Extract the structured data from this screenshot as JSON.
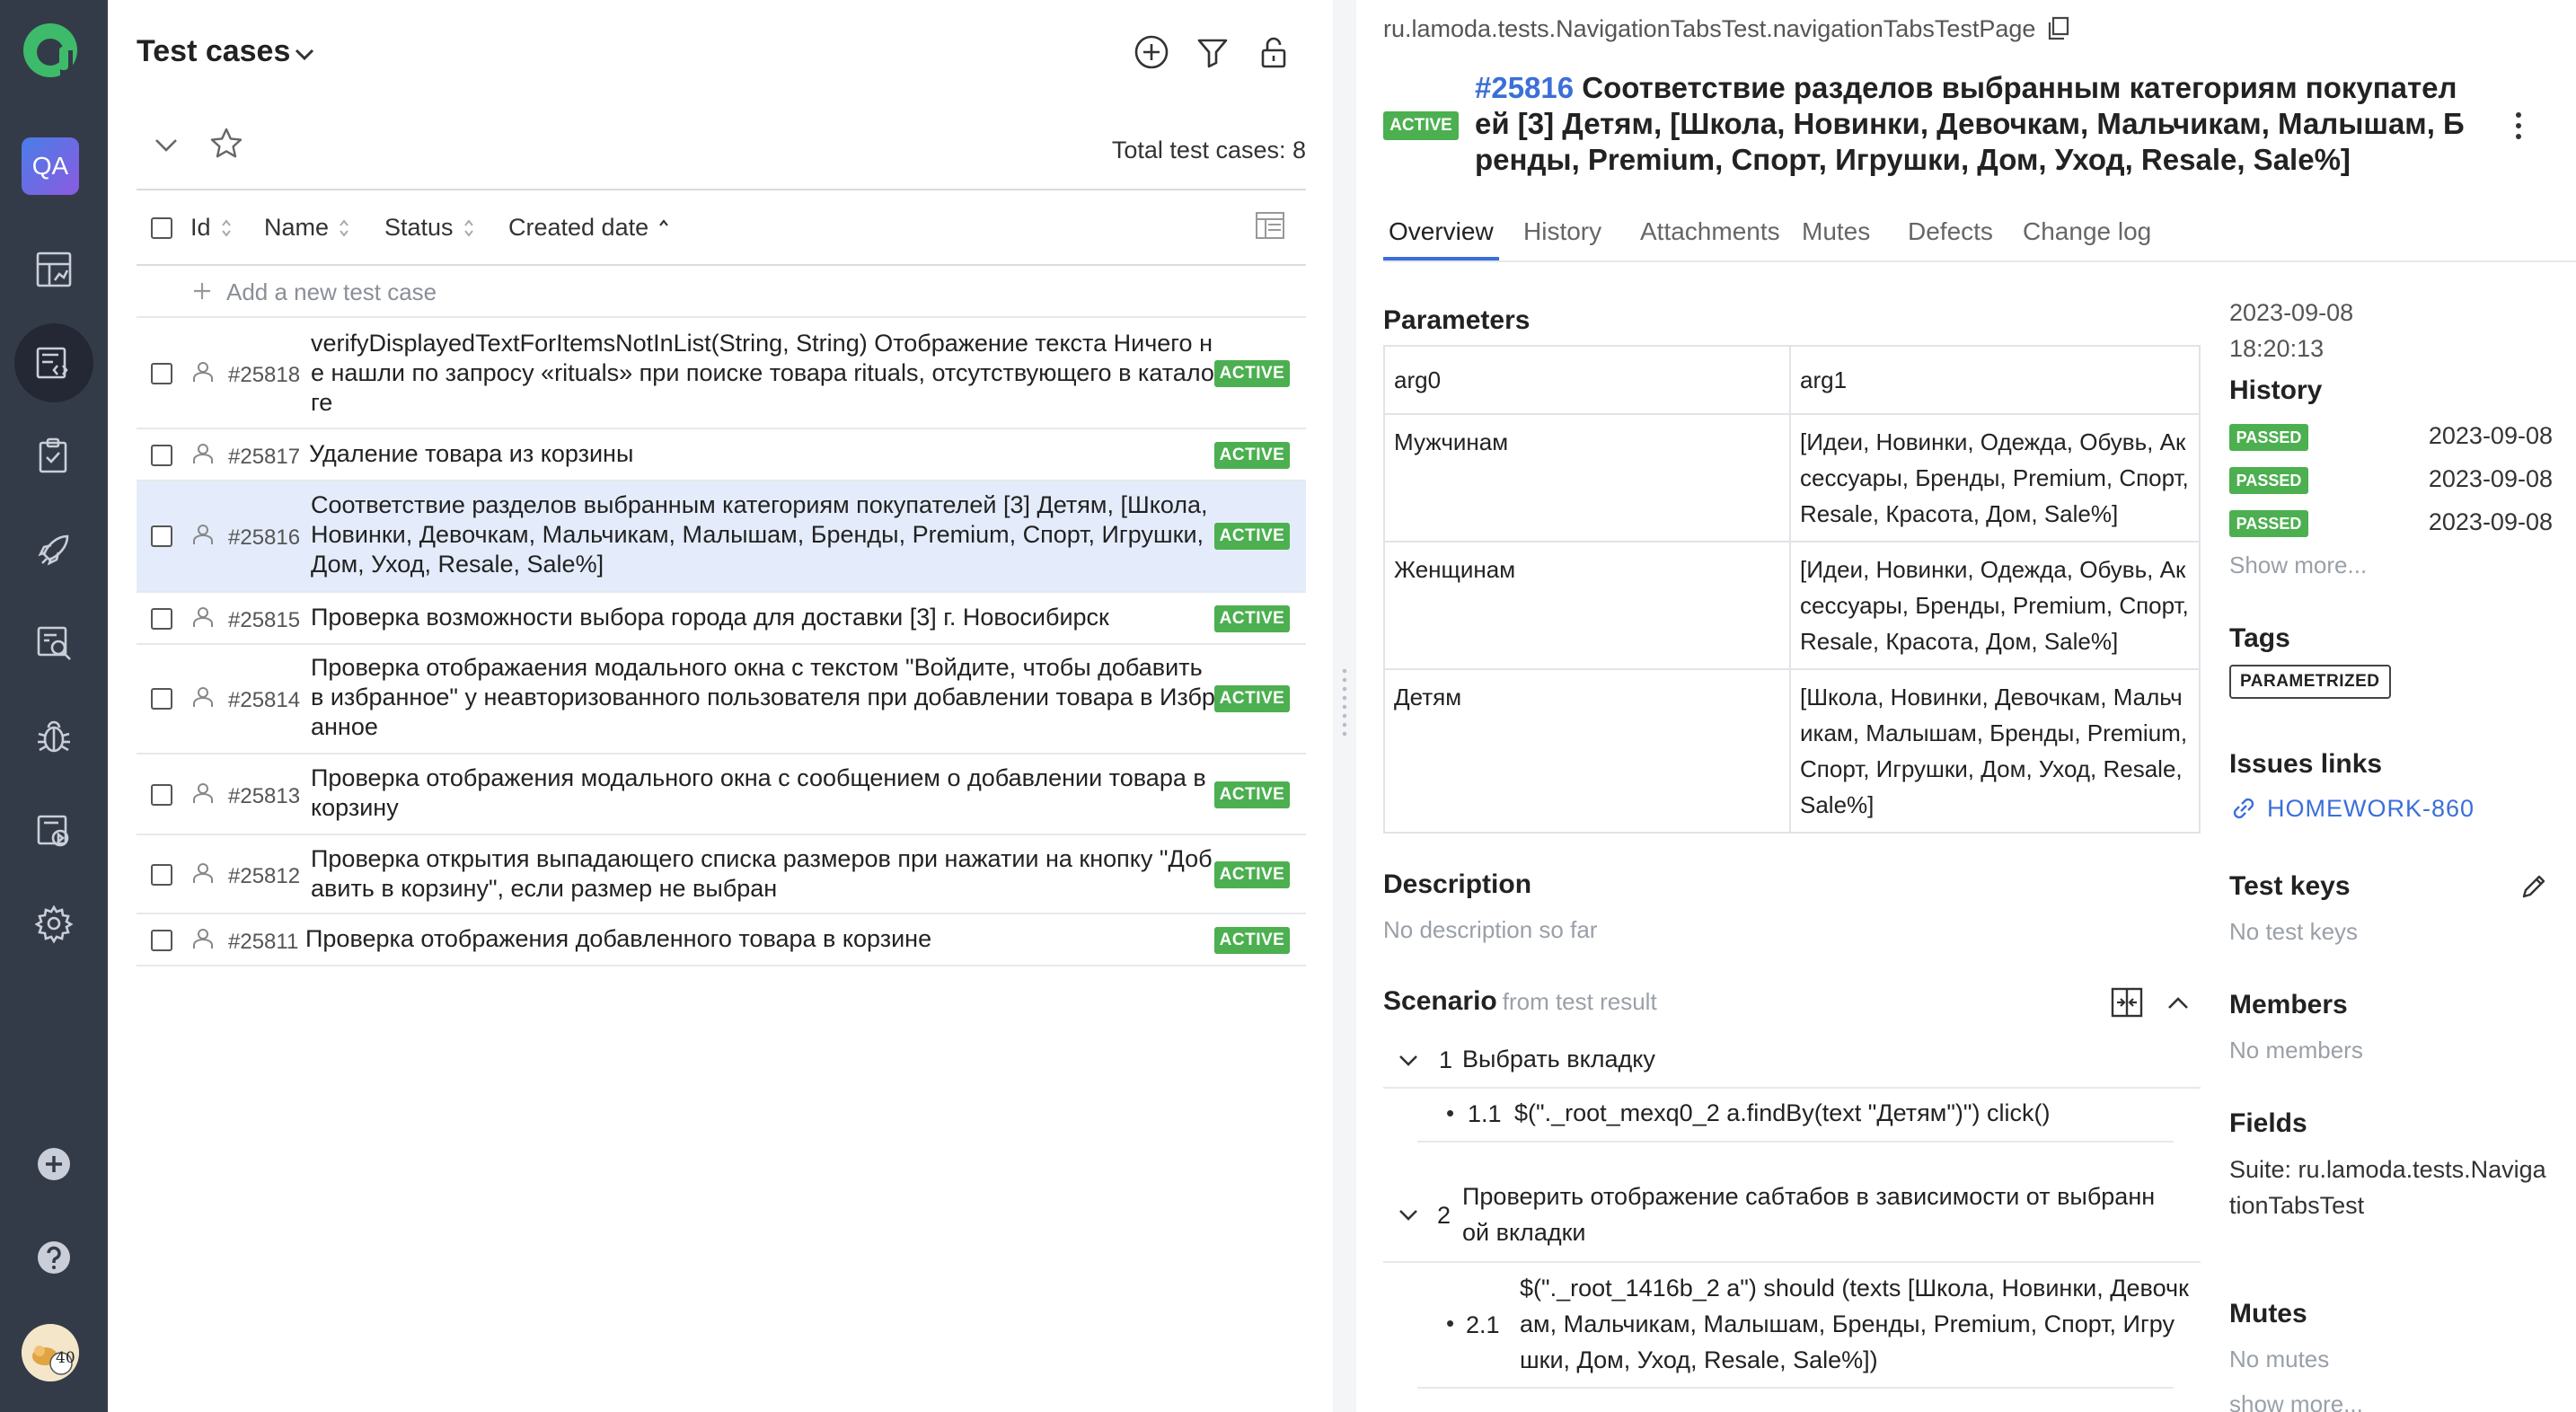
{
  "sidebar": {
    "project_label": "QA",
    "avatar_badge": "40",
    "items": [
      {
        "name": "dashboards",
        "icon": "dashboard-icon"
      },
      {
        "name": "test-cases",
        "icon": "test-cases-icon",
        "active": true
      },
      {
        "name": "test-plans",
        "icon": "test-plans-icon"
      },
      {
        "name": "launches",
        "icon": "rocket-icon"
      },
      {
        "name": "analytics",
        "icon": "search-analytics-icon"
      },
      {
        "name": "defects",
        "icon": "bug-icon"
      },
      {
        "name": "jobs",
        "icon": "jobs-icon"
      },
      {
        "name": "settings",
        "icon": "gear-icon"
      }
    ]
  },
  "list": {
    "title": "Test cases",
    "total_label": "Total test cases: 8",
    "columns": [
      "Id",
      "Name",
      "Status",
      "Created date"
    ],
    "add_placeholder": "Add a new test case",
    "rows": [
      {
        "id": "#25818",
        "name": "verifyDisplayedTextForItemsNotInList(String, String) Отображение текста Ничего не нашли по запросу «rituals» при поиске товара rituals, отсутствующего в каталоге",
        "status": "ACTIVE"
      },
      {
        "id": "#25817",
        "name": "Удаление товара из корзины",
        "status": "ACTIVE"
      },
      {
        "id": "#25816",
        "name": "Соответствие разделов выбранным категориям покупателей [3] Детям, [Школа, Новинки, Девочкам, Мальчикам, Малышам, Бренды, Premium, Спорт, Игрушки, Дом, Уход, Resale, Sale%]",
        "status": "ACTIVE",
        "selected": true
      },
      {
        "id": "#25815",
        "name": "Проверка возможности выбора города для доставки [3] г. Новосибирск",
        "status": "ACTIVE"
      },
      {
        "id": "#25814",
        "name": "Проверка отображаения модального окна с текстом \"Войдите, чтобы добавить в избранное\" у неавторизованного пользователя при добавлении товара в Избранное",
        "status": "ACTIVE"
      },
      {
        "id": "#25813",
        "name": "Проверка отображения модального окна с сообщением о добавлении товара в корзину",
        "status": "ACTIVE"
      },
      {
        "id": "#25812",
        "name": "Проверка открытия выпадающего списка размеров при нажатии на кнопку \"Добавить в корзину\", если размер не выбран",
        "status": "ACTIVE"
      },
      {
        "id": "#25811",
        "name": "Проверка отображения добавленного товара в корзине",
        "status": "ACTIVE"
      }
    ]
  },
  "detail": {
    "path": "ru.lamoda.tests.NavigationTabsTest.navigationTabsTestPage",
    "status": "ACTIVE",
    "id": "#25816",
    "title": "Соответствие разделов выбранным категориям покупателей [3] Детям, [Школа, Новинки, Девочкам, Мальчикам, Малышам, Бренды, Premium, Спорт, Игрушки, Дом, Уход, Resale, Sale%]",
    "tabs": [
      "Overview",
      "History",
      "Attachments",
      "Mutes",
      "Defects",
      "Change log"
    ],
    "parameters_title": "Parameters",
    "parameters": {
      "headers": [
        "arg0",
        "arg1"
      ],
      "rows": [
        [
          "Мужчинам",
          "[Идеи, Новинки, Одежда, Обувь, Аксессуары, Бренды, Premium, Спорт, Resale, Красота, Дом, Sale%]"
        ],
        [
          "Женщинам",
          "[Идеи, Новинки, Одежда, Обувь, Аксессуары, Бренды, Premium, Спорт, Resale, Красота, Дом, Sale%]"
        ],
        [
          "Детям",
          "[Школа, Новинки, Девочкам, Мальчикам, Малышам, Бренды, Premium, Спорт, Игрушки, Дом, Уход, Resale, Sale%]"
        ]
      ]
    },
    "description_title": "Description",
    "description_empty": "No description so far",
    "scenario_title": "Scenario",
    "scenario_sub": "from test result",
    "scenario": [
      {
        "num": "1",
        "text": "Выбрать вкладку",
        "sub": [
          {
            "num": "1.1",
            "text": "$(\"._root_mexq0_2 a.findBy(text \"Детям\")\") click()"
          }
        ]
      },
      {
        "num": "2",
        "text": "Проверить отображение сабтабов в зависимости от выбранной вкладки",
        "sub": [
          {
            "num": "2.1",
            "text": "$(\"._root_1416b_2 a\") should (texts [Школа, Новинки, Девочкам, Мальчикам, Малышам, Бренды, Premium, Спорт, Игрушки, Дом, Уход, Resale, Sale%])"
          }
        ]
      }
    ],
    "side": {
      "date": "2023-09-08",
      "time": "18:20:13",
      "history_title": "History",
      "history": [
        {
          "status": "PASSED",
          "date": "2023-09-08"
        },
        {
          "status": "PASSED",
          "date": "2023-09-08"
        },
        {
          "status": "PASSED",
          "date": "2023-09-08"
        }
      ],
      "show_more": "Show more...",
      "tags_title": "Tags",
      "tag": "PARAMETRIZED",
      "issues_title": "Issues links",
      "issue": "HOMEWORK-860",
      "keys_title": "Test keys",
      "keys_empty": "No test keys",
      "members_title": "Members",
      "members_empty": "No members",
      "fields_title": "Fields",
      "fields_text": "Suite: ru.lamoda.tests.NavigationTabsTest",
      "mutes_title": "Mutes",
      "mutes_empty": "No mutes",
      "show_more_lower": "show more..."
    }
  },
  "colors": {
    "rail": "#343b48",
    "accent": "#3b6fd9",
    "active_badge": "#4caf50",
    "selected_row": "#e4ecfb"
  }
}
